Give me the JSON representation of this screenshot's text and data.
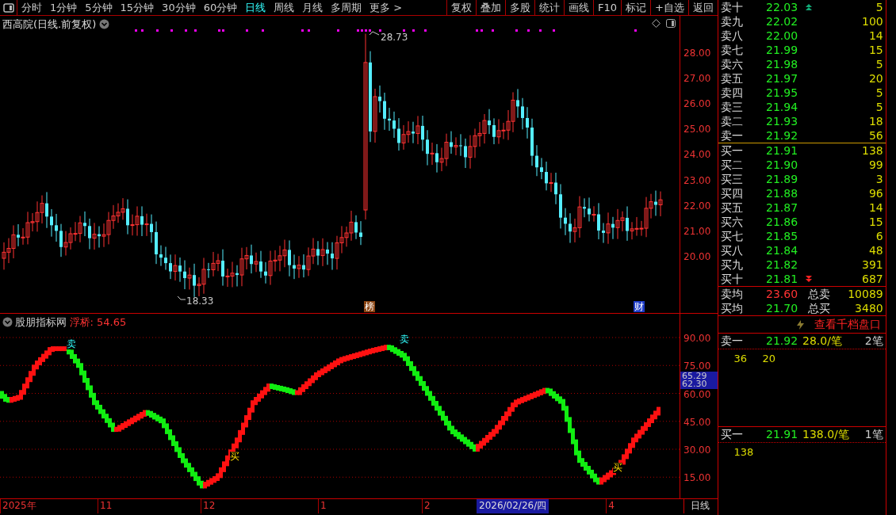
{
  "toolbar": {
    "periods": [
      {
        "label": "分时",
        "selected": false
      },
      {
        "label": "1分钟",
        "selected": false
      },
      {
        "label": "5分钟",
        "selected": false
      },
      {
        "label": "15分钟",
        "selected": false
      },
      {
        "label": "30分钟",
        "selected": false
      },
      {
        "label": "60分钟",
        "selected": false
      },
      {
        "label": "日线",
        "selected": true
      },
      {
        "label": "周线",
        "selected": false
      },
      {
        "label": "月线",
        "selected": false
      },
      {
        "label": "多周期",
        "selected": false
      },
      {
        "label": "更多 >",
        "selected": false
      }
    ],
    "actions": [
      "复权",
      "叠加",
      "多股",
      "统计",
      "画线",
      "F10",
      "标记",
      "+自选",
      "返回"
    ]
  },
  "chart": {
    "title": "西高院(日线.前复权)",
    "price_axis": [
      "28.00",
      "27.00",
      "26.00",
      "25.00",
      "24.00",
      "23.00",
      "22.00",
      "21.00",
      "20.00"
    ],
    "high_label": "28.73",
    "low_label": "18.33",
    "badges": [
      {
        "text": "榜",
        "color": "#8b4513"
      },
      {
        "text": "财",
        "color": "#1e3cc8"
      }
    ]
  },
  "indicator": {
    "name": "股朋指标网",
    "reading": "浮桥: 54.65",
    "axis": [
      "90.00",
      "75.00",
      "60.00",
      "45.00",
      "30.00",
      "15.00"
    ],
    "cursor_values": [
      "65.29",
      "62.30"
    ],
    "signals": [
      {
        "text": "卖",
        "kind": "sell"
      },
      {
        "text": "卖",
        "kind": "sell"
      },
      {
        "text": "买",
        "kind": "buy"
      },
      {
        "text": "买",
        "kind": "buy"
      }
    ]
  },
  "time_axis": {
    "labels": [
      "2025年",
      "11",
      "12",
      "1",
      "2",
      "4"
    ],
    "cursor_date": "2026/02/26/四",
    "period": "日线"
  },
  "order_book": {
    "asks": [
      {
        "label": "卖十",
        "price": "22.03",
        "volume": "5"
      },
      {
        "label": "卖九",
        "price": "22.02",
        "volume": "100"
      },
      {
        "label": "卖八",
        "price": "22.00",
        "volume": "14"
      },
      {
        "label": "卖七",
        "price": "21.99",
        "volume": "15"
      },
      {
        "label": "卖六",
        "price": "21.98",
        "volume": "5"
      },
      {
        "label": "卖五",
        "price": "21.97",
        "volume": "20"
      },
      {
        "label": "卖四",
        "price": "21.95",
        "volume": "5"
      },
      {
        "label": "卖三",
        "price": "21.94",
        "volume": "5"
      },
      {
        "label": "卖二",
        "price": "21.93",
        "volume": "18"
      },
      {
        "label": "卖一",
        "price": "21.92",
        "volume": "56"
      }
    ],
    "bids": [
      {
        "label": "买一",
        "price": "21.91",
        "volume": "138"
      },
      {
        "label": "买二",
        "price": "21.90",
        "volume": "99"
      },
      {
        "label": "买三",
        "price": "21.89",
        "volume": "3"
      },
      {
        "label": "买四",
        "price": "21.88",
        "volume": "96"
      },
      {
        "label": "买五",
        "price": "21.87",
        "volume": "14"
      },
      {
        "label": "买六",
        "price": "21.86",
        "volume": "15"
      },
      {
        "label": "买七",
        "price": "21.85",
        "volume": "6"
      },
      {
        "label": "买八",
        "price": "21.84",
        "volume": "48"
      },
      {
        "label": "买九",
        "price": "21.82",
        "volume": "391"
      },
      {
        "label": "买十",
        "price": "21.81",
        "volume": "687"
      }
    ],
    "averages": [
      {
        "label": "卖均",
        "price": "23.60",
        "total_label": "总卖",
        "total": "10089",
        "kind": "sell"
      },
      {
        "label": "买均",
        "price": "21.70",
        "total_label": "总买",
        "total": "3480",
        "kind": "buy"
      }
    ],
    "deep_link": "查看千档盘口",
    "queues": [
      {
        "label": "卖一",
        "price": "21.92",
        "average": "28.0/笔",
        "count": "2笔",
        "orders": [
          "36",
          "20"
        ]
      },
      {
        "label": "买一",
        "price": "21.91",
        "average": "138.0/笔",
        "count": "1笔",
        "orders": [
          "138"
        ]
      }
    ]
  }
}
